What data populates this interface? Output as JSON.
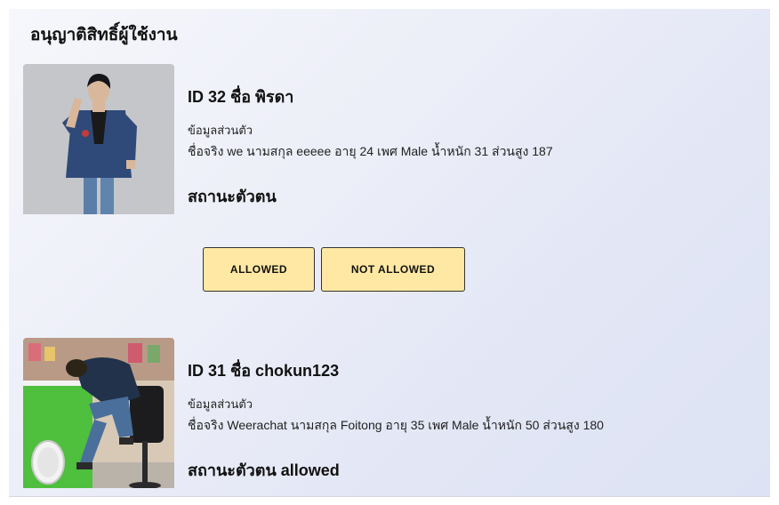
{
  "page": {
    "title": "อนุญาติสิทธิ์ผู้ใช้งาน"
  },
  "users": [
    {
      "heading": "ID 32 ชื่อ พิรดา",
      "personal_label": "ข้อมูลส่วนตัว",
      "personal_detail": "ชื่อจริง we นามสกุล eeeee อายุ 24 เพศ Male น้ำหนัก 31 ส่วนสูง 187",
      "status": "สถานะตัวตน"
    },
    {
      "heading": "ID 31 ชื่อ chokun123",
      "personal_label": "ข้อมูลส่วนตัว",
      "personal_detail": "ชื่อจริง Weerachat นามสกุล Foitong อายุ 35 เพศ Male น้ำหนัก 50 ส่วนสูง 180",
      "status": "สถานะตัวตน allowed"
    }
  ],
  "actions": {
    "allow_label": "ALLOWED",
    "deny_label": "NOT ALLOWED"
  },
  "colors": {
    "button_bg": "#ffe8a3",
    "panel_gradient_start": "#f6f7fb",
    "panel_gradient_end": "#dde3f4"
  }
}
